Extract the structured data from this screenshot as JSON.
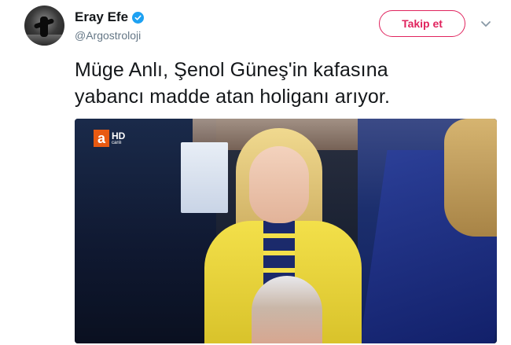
{
  "user": {
    "display_name": "Eray Efe",
    "handle": "@Argostroloji",
    "verified": true
  },
  "actions": {
    "follow_label": "Takip et"
  },
  "tweet": {
    "text": "Müge Anlı, Şenol Güneş'in kafasına\nyabancı madde atan holiganı arıyor."
  },
  "media": {
    "channel_logo": "a",
    "channel_hd": "HD",
    "channel_live": "canlı"
  },
  "colors": {
    "follow_accent": "#e0245e",
    "verified_blue": "#1da1f2",
    "text_primary": "#14171a",
    "text_secondary": "#657786"
  },
  "icons": {
    "verified": "verified-badge-icon",
    "more": "chevron-down-icon"
  }
}
